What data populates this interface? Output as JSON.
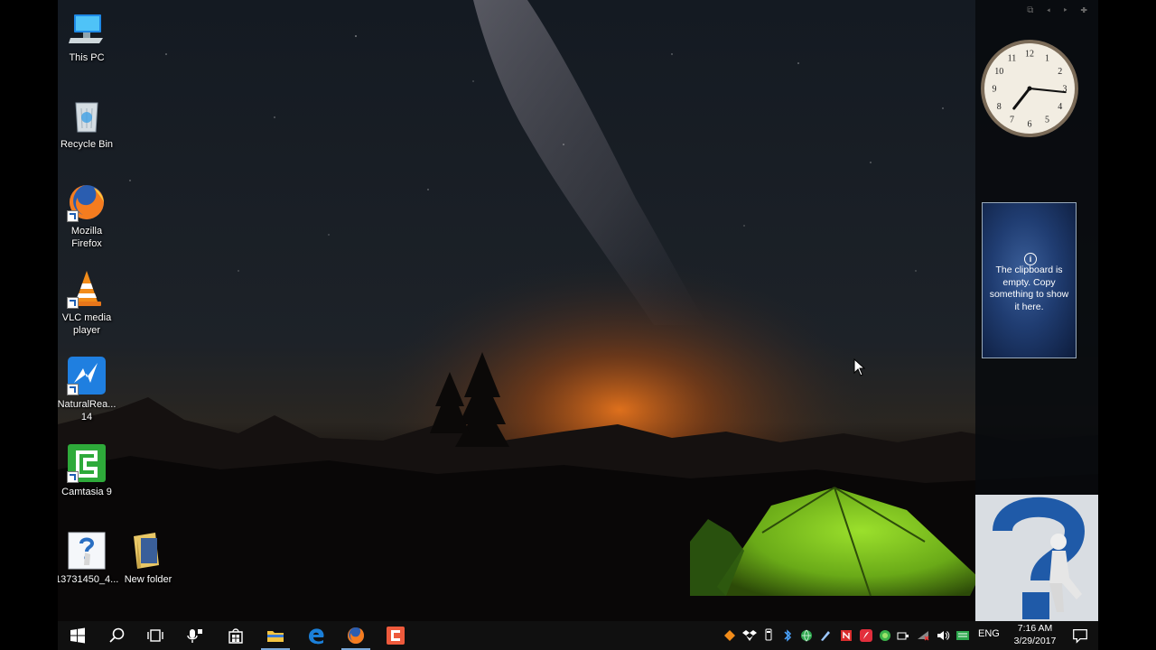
{
  "desktop": {
    "icons": [
      {
        "label": "This PC",
        "icon": "computer-icon"
      },
      {
        "label": "Recycle Bin",
        "icon": "recycle-bin-icon"
      },
      {
        "label": "Mozilla Firefox",
        "icon": "firefox-icon"
      },
      {
        "label": "VLC media player",
        "icon": "vlc-icon"
      },
      {
        "label": "NaturalRea... 14",
        "icon": "naturalreader-icon"
      },
      {
        "label": "Camtasia 9",
        "icon": "camtasia-icon"
      },
      {
        "label": "13731450_4...",
        "icon": "image-file-icon"
      },
      {
        "label": "New folder",
        "icon": "folder-icon"
      }
    ]
  },
  "gadgets": {
    "clock": {
      "time": "7:16",
      "numerals": [
        "12",
        "1",
        "2",
        "3",
        "4",
        "5",
        "6",
        "7",
        "8",
        "9",
        "10",
        "11"
      ]
    },
    "clipboard": {
      "message": "The clipboard is empty. Copy something to show it here."
    }
  },
  "taskbar": {
    "pinned": [
      "start-icon",
      "search-icon",
      "task-view-icon",
      "cortana-mic-icon",
      "store-icon",
      "file-explorer-icon",
      "edge-icon",
      "firefox-icon",
      "camtasia-icon"
    ],
    "language": "ENG",
    "time": "7:16 AM",
    "date": "3/29/2017"
  },
  "colors": {
    "taskbar": "#101010",
    "accent": "#7aa7d8",
    "sidebar": "#080a0e"
  }
}
